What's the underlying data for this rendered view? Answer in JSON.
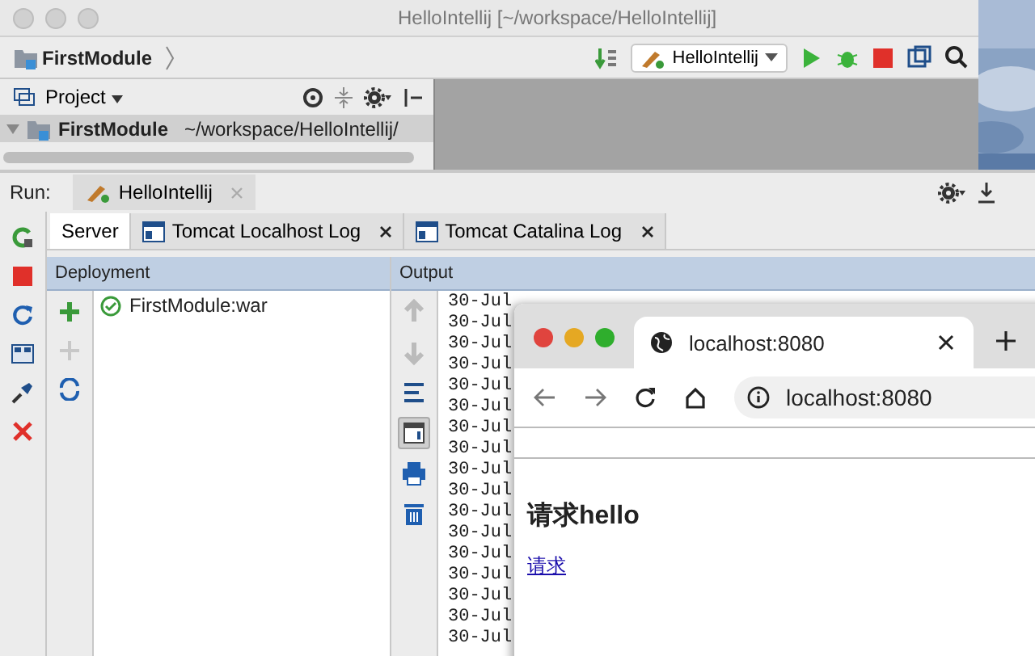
{
  "window": {
    "title": "HelloIntellij [~/workspace/HelloIntellij]"
  },
  "navbar": {
    "breadcrumb": "FirstModule",
    "run_config": "HelloIntellij"
  },
  "project_panel": {
    "title": "Project",
    "tree": [
      {
        "label": "FirstModule",
        "path": "~/workspace/HelloIntellij/",
        "selected": true
      }
    ]
  },
  "run_panel": {
    "label": "Run:",
    "tab": {
      "label": "HelloIntellij",
      "selected": true
    },
    "tabs": [
      {
        "label": "Server",
        "selected": true,
        "closable": false
      },
      {
        "label": "Tomcat Localhost Log",
        "selected": false,
        "closable": true
      },
      {
        "label": "Tomcat Catalina Log",
        "selected": false,
        "closable": true
      }
    ],
    "deployment": {
      "header": "Deployment",
      "items": [
        "FirstModule:war"
      ]
    },
    "output": {
      "header": "Output",
      "toolbar": [
        {
          "kind": "up",
          "pressed": false
        },
        {
          "kind": "down",
          "pressed": false
        },
        {
          "kind": "wrap",
          "pressed": false
        },
        {
          "kind": "scroll",
          "pressed": true
        },
        {
          "kind": "print",
          "pressed": false
        },
        {
          "kind": "trash",
          "pressed": false
        }
      ],
      "lines": [
        "30-Jul",
        "30-Jul",
        "30-Jul",
        "30-Jul",
        "30-Jul",
        "30-Jul",
        "30-Jul",
        "30-Jul",
        "30-Jul",
        "30-Jul",
        "30-Jul",
        "30-Jul",
        "30-Jul",
        "30-Jul",
        "30-Jul",
        "30-Jul",
        "30-Jul"
      ]
    }
  },
  "browser": {
    "tab": "localhost:8080",
    "address": "localhost:8080",
    "heading": "请求hello",
    "link": "请求"
  }
}
